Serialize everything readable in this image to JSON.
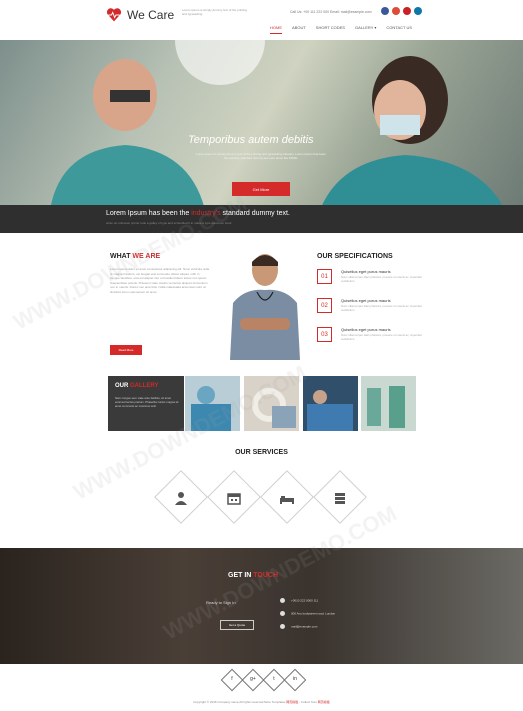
{
  "header": {
    "brand": "We Care",
    "tagline": "Lorem ipsum is simply dummy text of the printing and typesetting",
    "contact": "Call Us: +00 111 222 000    Email: mail@example.com",
    "nav": [
      "HOME",
      "ABOUT",
      "SHORT CODES",
      "GALLERY ▾",
      "CONTACT US"
    ],
    "social_colors": [
      "#3b5998",
      "#dd4b39",
      "#cb2027",
      "#0e76a8"
    ]
  },
  "hero": {
    "title": "Temporibus autem debitis",
    "subtitle": "Lorem ipsum is simply dummy text of the printing and typesetting industry. Lorem Ipsum has been the industry standard dummy text ever since the 1500s.",
    "button": "Get More",
    "bar_text_pre": "Lorem Ipsum has been the",
    "bar_text_hl": "industry's",
    "bar_text_post": "standard dummy text.",
    "bar_sub": "when an unknown printer took a galley of type and scrambled it to make a type specimen book"
  },
  "about": {
    "title_pre": "WHAT ",
    "title_hl": "WE ARE",
    "text": "Lorem ipsum dolor sit amet consectetur adipiscing elit. Nunc vehicula nulla ut magna tincidunt, vel feugiat erat commodo. Etiam aliquet, nibh in congue faucibus, erat est aliquet nisl, et tincidunt libero lectus non ipsum. Suspendisse potenti. Praesent vitae mauris vel lectus aliquam fermentum non in mauris. Donec nec ante felis. Nulla malesuada accumsan velit, at tincidunt lorem elementum sit amet.",
    "button": "Read More"
  },
  "specs": {
    "title": "OUR SPECIFICATIONS",
    "items": [
      {
        "num": "01",
        "title": "Quisellus eget purus mauris",
        "desc": "Nunc ullamcorper diam pharetra, posuere ut mauris ac, imperdiet vestibulum."
      },
      {
        "num": "02",
        "title": "Quisellus eget purus mauris",
        "desc": "Nunc ullamcorper diam pharetra, posuere ut mauris ac, imperdiet vestibulum."
      },
      {
        "num": "03",
        "title": "Quisellus eget purus mauris",
        "desc": "Nunc ullamcorper diam pharetra, posuere ut mauris ac, imperdiet vestibulum."
      }
    ]
  },
  "gallery": {
    "title_pre": "OUR ",
    "title_hl": "GALLERY",
    "text": "Nam congue sem vitae ante facilisis, sit amet euismod lectus pretium. Phasellus luctus magna sit amet commodo ac maximus velit."
  },
  "services": {
    "title": "OUR SERVICES",
    "icons": [
      "user-icon",
      "calendar-icon",
      "bed-icon",
      "server-icon"
    ]
  },
  "touch": {
    "title_pre": "GET IN ",
    "title_hl": "TOUCH",
    "left": "Ready to Sign In",
    "button": "Get a Quote",
    "items": [
      "+0010 222 0000 111",
      "000 Any bodystreet road, London",
      "mail@example.com"
    ]
  },
  "footer": {
    "social": [
      "f",
      "g+",
      "t",
      "in"
    ],
    "copy_pre": "Copyright © 2016 Company name All rights reserved.More Templates ",
    "copy_hl": "网页模板",
    "copy_post": " - Collect from ",
    "copy_hl2": "网页模板"
  },
  "watermark": "WWW.DOWNDEMO.COM"
}
